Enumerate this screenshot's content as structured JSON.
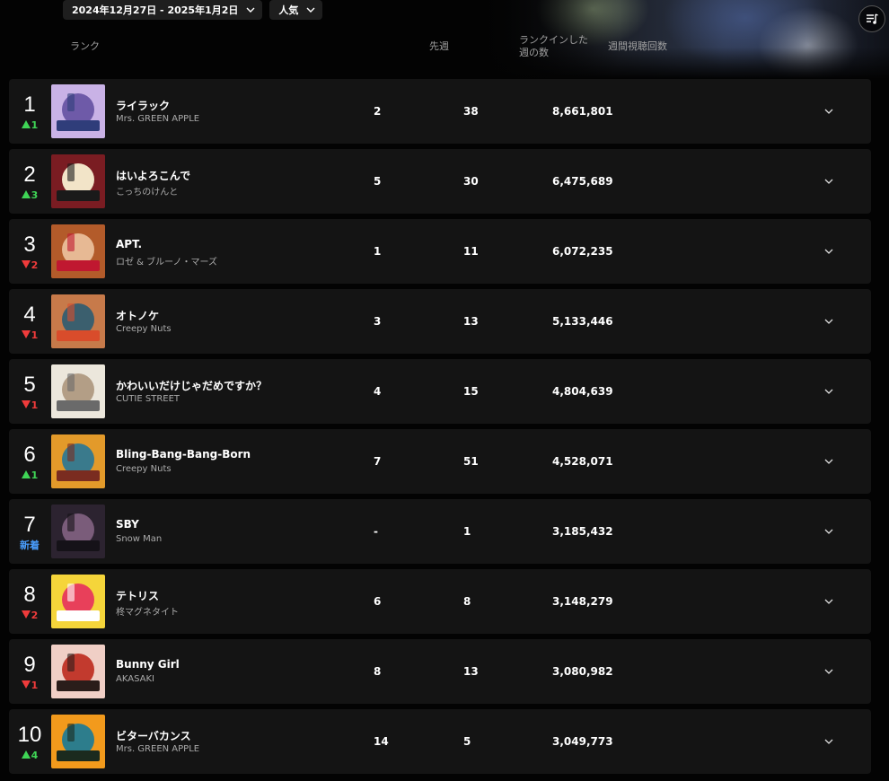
{
  "filters": {
    "date_range": "2024年12月27日 - 2025年1月2日",
    "sort": "人気"
  },
  "columns": {
    "rank": "ランク",
    "last_week": "先週",
    "weeks_on_chart": "ランクインした週の数",
    "weekly_views": "週間視聴回数"
  },
  "rows": [
    {
      "rank": "1",
      "change_dir": "up",
      "change": "1",
      "title": "ライラック",
      "artist": "Mrs. GREEN APPLE",
      "last_week": "2",
      "weeks": "38",
      "views": "8,661,801",
      "thumb": {
        "bg": "#c9b2e6",
        "fg": "#6e5aa8",
        "accent": "#2f3d7a"
      }
    },
    {
      "rank": "2",
      "change_dir": "up",
      "change": "3",
      "title": "はいよろこんで",
      "artist": "こっちのけんと",
      "last_week": "5",
      "weeks": "30",
      "views": "6,475,689",
      "thumb": {
        "bg": "#7a1c22",
        "fg": "#f2e4c8",
        "accent": "#1a1a1a"
      }
    },
    {
      "rank": "3",
      "change_dir": "down",
      "change": "2",
      "title": "APT.",
      "artist": "ロゼ & ブルーノ・マーズ",
      "last_week": "1",
      "weeks": "11",
      "views": "6,072,235",
      "thumb": {
        "bg": "#b35b2a",
        "fg": "#e7b994",
        "accent": "#c01830"
      }
    },
    {
      "rank": "4",
      "change_dir": "down",
      "change": "1",
      "title": "オトノケ",
      "artist": "Creepy Nuts",
      "last_week": "3",
      "weeks": "13",
      "views": "5,133,446",
      "thumb": {
        "bg": "#c77a4a",
        "fg": "#3b5f6e",
        "accent": "#d94c2b"
      }
    },
    {
      "rank": "5",
      "change_dir": "down",
      "change": "1",
      "title": "かわいいだけじゃだめですか？",
      "artist": "CUTIE STREET",
      "last_week": "4",
      "weeks": "15",
      "views": "4,804,639",
      "thumb": {
        "bg": "#ece7dc",
        "fg": "#b39e86",
        "accent": "#6a6a6a"
      }
    },
    {
      "rank": "6",
      "change_dir": "up",
      "change": "1",
      "title": "Bling-Bang-Bang-Born",
      "artist": "Creepy Nuts",
      "last_week": "7",
      "weeks": "51",
      "views": "4,528,071",
      "thumb": {
        "bg": "#e39a2a",
        "fg": "#3a7a8c",
        "accent": "#7a2c20"
      }
    },
    {
      "rank": "7",
      "change_dir": "new",
      "change": "新着",
      "title": "SBY",
      "artist": "Snow Man",
      "last_week": "-",
      "weeks": "1",
      "views": "3,185,432",
      "thumb": {
        "bg": "#2c2330",
        "fg": "#7a5c7a",
        "accent": "#151218"
      }
    },
    {
      "rank": "8",
      "change_dir": "down",
      "change": "2",
      "title": "テトリス",
      "artist": "柊マグネタイト",
      "last_week": "6",
      "weeks": "8",
      "views": "3,148,279",
      "thumb": {
        "bg": "#f5d53a",
        "fg": "#e8405a",
        "accent": "#ffffff"
      }
    },
    {
      "rank": "9",
      "change_dir": "down",
      "change": "1",
      "title": "Bunny Girl",
      "artist": "AKASAKI",
      "last_week": "8",
      "weeks": "13",
      "views": "3,080,982",
      "thumb": {
        "bg": "#f0cfc6",
        "fg": "#c23a2e",
        "accent": "#2a1d1a"
      }
    },
    {
      "rank": "10",
      "change_dir": "up",
      "change": "4",
      "title": "ビターバカンス",
      "artist": "Mrs. GREEN APPLE",
      "last_week": "14",
      "weeks": "5",
      "views": "3,049,773",
      "thumb": {
        "bg": "#f29a1c",
        "fg": "#2d7d8c",
        "accent": "#1b2a1e"
      }
    }
  ]
}
